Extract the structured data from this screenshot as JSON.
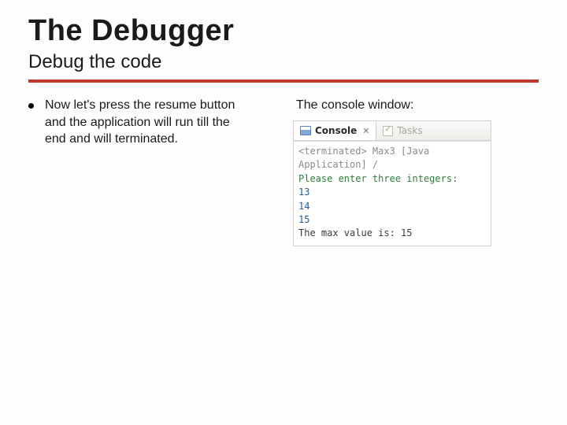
{
  "title": "The Debugger",
  "subtitle": "Debug the code",
  "left": {
    "bullet": "Now let's press the resume button and the application will run till the end and will terminated."
  },
  "right": {
    "heading": "The console window:",
    "tabs": {
      "console": "Console",
      "tasks": "Tasks"
    },
    "console": {
      "header": "<terminated> Max3 [Java Application] /",
      "prompt": "Please enter three integers:",
      "inputs": [
        "13",
        "14",
        "15"
      ],
      "output": "The max value is: 15"
    }
  }
}
